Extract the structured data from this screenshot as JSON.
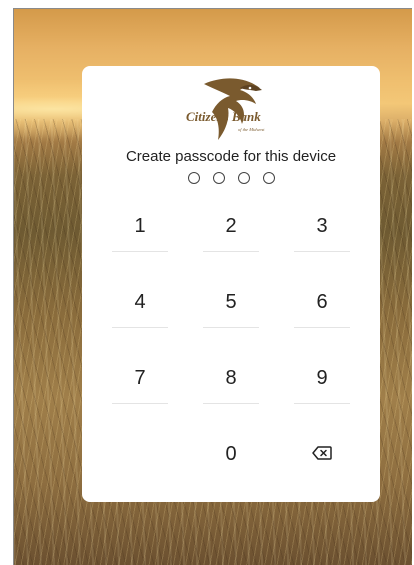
{
  "brand": {
    "logo_text": "Citizens Bank",
    "logo_tagline": "of the Midwest",
    "logo_icon": "eagle-icon",
    "logo_color": "#7a5a2e"
  },
  "prompt": {
    "text": "Create passcode for this device"
  },
  "passcode": {
    "length": 4,
    "entered": 0
  },
  "keypad": {
    "keys": [
      "1",
      "2",
      "3",
      "4",
      "5",
      "6",
      "7",
      "8",
      "9",
      "",
      "0",
      "⌫"
    ],
    "backspace_icon": "backspace-icon"
  }
}
